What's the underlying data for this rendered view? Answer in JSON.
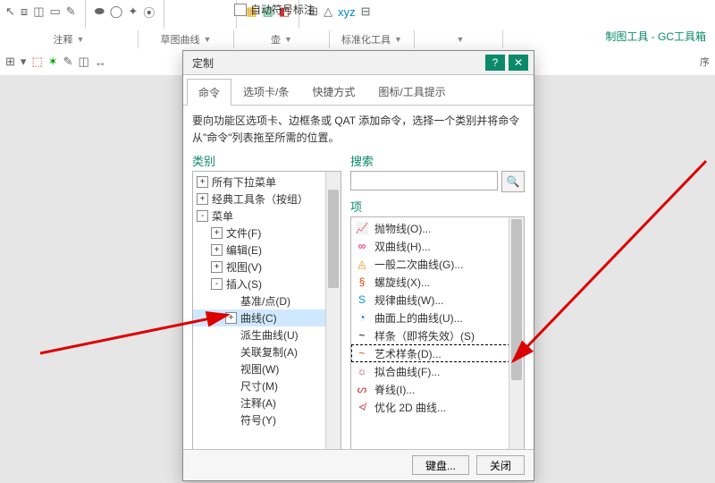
{
  "ribbon": {
    "groups": [
      {
        "label": "注释",
        "width": 142
      },
      {
        "label": "草图曲线",
        "width": 94
      },
      {
        "label": "壶",
        "width": 94
      },
      {
        "label": "标准化工具",
        "width": 82
      },
      {
        "label": "",
        "width": 86
      }
    ],
    "autolabel": "自动符号标注",
    "gc": "制图工具 - GC工具箱",
    "second_group": "序"
  },
  "dialog": {
    "title": "定制",
    "tabs": [
      "命令",
      "选项卡/条",
      "快捷方式",
      "图标/工具提示"
    ],
    "active_tab": 0,
    "instruction": "要向功能区选项卡、边框条或 QAT 添加命令，选择一个类别并将命令从\"命令\"列表拖至所需的位置。",
    "categories_label": "类别",
    "search_label": "搜索",
    "items_label": "项",
    "search_placeholder": "",
    "footer": {
      "keyboard": "键盘...",
      "close": "关闭"
    },
    "tree": [
      {
        "indent": 0,
        "tw": "+",
        "label": "所有下拉菜单"
      },
      {
        "indent": 0,
        "tw": "+",
        "label": "经典工具条（按组）"
      },
      {
        "indent": 0,
        "tw": "-",
        "label": "菜单"
      },
      {
        "indent": 1,
        "tw": "+",
        "label": "文件(F)"
      },
      {
        "indent": 1,
        "tw": "+",
        "label": "编辑(E)"
      },
      {
        "indent": 1,
        "tw": "+",
        "label": "视图(V)"
      },
      {
        "indent": 1,
        "tw": "-",
        "label": "插入(S)"
      },
      {
        "indent": 2,
        "tw": "",
        "label": "基准/点(D)"
      },
      {
        "indent": 2,
        "tw": "+",
        "label": "曲线(C)",
        "sel": true
      },
      {
        "indent": 2,
        "tw": "",
        "label": "派生曲线(U)"
      },
      {
        "indent": 2,
        "tw": "",
        "label": "关联复制(A)"
      },
      {
        "indent": 2,
        "tw": "",
        "label": "视图(W)"
      },
      {
        "indent": 2,
        "tw": "",
        "label": "尺寸(M)"
      },
      {
        "indent": 2,
        "tw": "",
        "label": "注释(A)"
      },
      {
        "indent": 2,
        "tw": "",
        "label": "符号(Y)"
      }
    ],
    "items": [
      {
        "ico": "📈",
        "c": "#0aa",
        "label": "抛物线(O)..."
      },
      {
        "ico": "∞",
        "c": "#e06",
        "label": "双曲线(H)..."
      },
      {
        "ico": "◬",
        "c": "#e80",
        "label": "一般二次曲线(G)..."
      },
      {
        "ico": "§",
        "c": "#c40",
        "label": "螺旋线(X)..."
      },
      {
        "ico": "S",
        "c": "#09c",
        "label": "规律曲线(W)..."
      },
      {
        "ico": "◔",
        "c": "#07c",
        "label": "曲面上的曲线(U)..."
      },
      {
        "ico": "~",
        "c": "#000",
        "label": "样条（即将失效）(S)"
      },
      {
        "ico": "~",
        "c": "#c50",
        "label": "艺术样条(D)...",
        "sel": true
      },
      {
        "ico": "☼",
        "c": "#a33",
        "label": "拟合曲线(F)..."
      },
      {
        "ico": "ᔕ",
        "c": "#c33",
        "label": "脊线(I)..."
      },
      {
        "ico": "≮",
        "c": "#c33",
        "label": "优化 2D 曲线..."
      }
    ]
  }
}
